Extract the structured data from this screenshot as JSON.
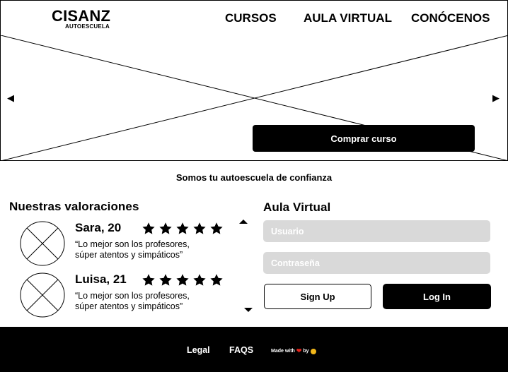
{
  "header": {
    "logo": "CISANZ",
    "logo_sub": "AUTOESCUELA",
    "nav": [
      "CURSOS",
      "AULA VIRTUAL",
      "CONÓCENOS"
    ]
  },
  "hero": {
    "prev": "◀",
    "next": "▶",
    "cta": "Comprar curso"
  },
  "tagline": "Somos tu autoescuela de confianza",
  "reviews": {
    "title": "Nuestras valoraciones",
    "items": [
      {
        "name": "Sara, 20",
        "rating": 5,
        "text_line1": "“Lo mejor son los profesores,",
        "text_line2": "súper atentos y simpáticos”"
      },
      {
        "name": "Luisa, 21",
        "rating": 5,
        "text_line1": "“Lo mejor son los profesores,",
        "text_line2": "súper atentos y simpáticos”"
      }
    ]
  },
  "login": {
    "title": "Aula Virtual",
    "user_placeholder": "Usuario",
    "pass_placeholder": "Contraseña",
    "signup": "Sign Up",
    "login": "Log In"
  },
  "footer": {
    "legal": "Legal",
    "faqs": "FAQS",
    "made_with": "Made with",
    "by": "by"
  },
  "colors": {
    "primary": "#000000",
    "input_bg": "#d9d9d9",
    "heart": "#e2231a",
    "emoji": "#f2b71a"
  }
}
